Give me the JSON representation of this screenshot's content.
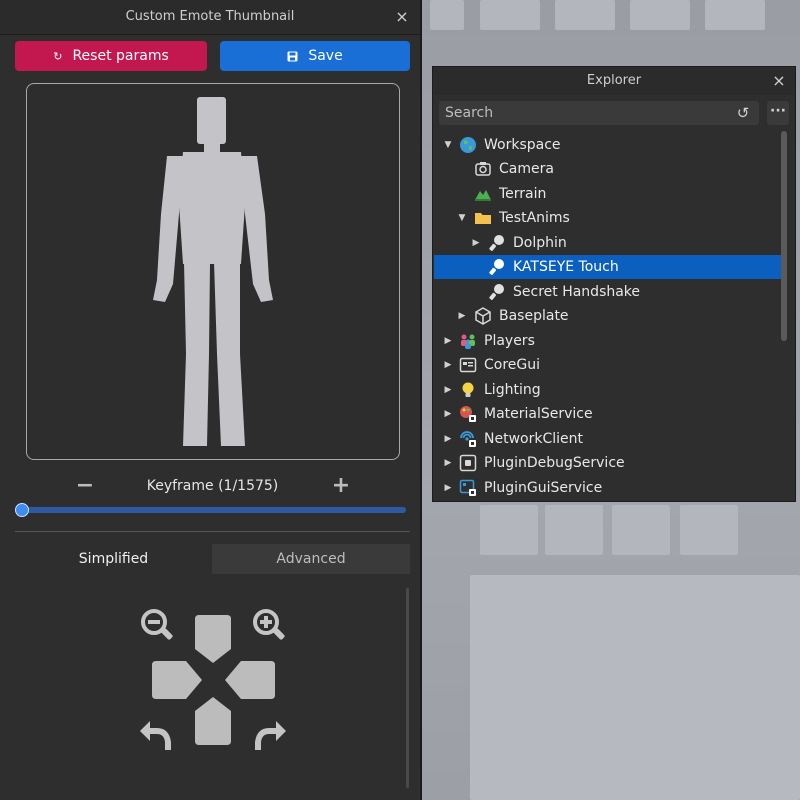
{
  "emote_panel": {
    "title": "Custom Emote Thumbnail",
    "close": "×",
    "reset_label": "Reset params",
    "save_label": "Save",
    "keyframe_minus": "−",
    "keyframe_label": "Keyframe (1/1575)",
    "keyframe_plus": "+",
    "keyframe_progress": 0.0,
    "tabs": {
      "simplified": "Simplified",
      "advanced": "Advanced"
    },
    "active_tab": "Simplified",
    "controls": [
      "zoom-out-icon",
      "zoom-in-icon",
      "pan-up-button",
      "pan-left-button",
      "pan-right-button",
      "pan-down-button",
      "rotate-left-icon",
      "rotate-right-icon"
    ]
  },
  "explorer": {
    "title": "Explorer",
    "close": "×",
    "search_placeholder": "Search",
    "history_icon": "↺",
    "more_icon": "···",
    "items": [
      {
        "label": "Workspace",
        "icon": "globe-icon",
        "expanded": true
      },
      {
        "label": "Camera",
        "icon": "camera-icon"
      },
      {
        "label": "Terrain",
        "icon": "terrain-icon"
      },
      {
        "label": "TestAnims",
        "icon": "folder-icon",
        "expanded": true
      },
      {
        "label": "Dolphin",
        "icon": "animation-icon",
        "expanded": false
      },
      {
        "label": "KATSEYE Touch",
        "icon": "animation-icon",
        "selected": true
      },
      {
        "label": "Secret Handshake",
        "icon": "animation-icon"
      },
      {
        "label": "Baseplate",
        "icon": "part-icon",
        "expanded": false
      },
      {
        "label": "Players",
        "icon": "players-icon",
        "expanded": false
      },
      {
        "label": "CoreGui",
        "icon": "coregui-icon",
        "expanded": false
      },
      {
        "label": "Lighting",
        "icon": "lightbulb-icon",
        "expanded": false
      },
      {
        "label": "MaterialService",
        "icon": "material-service-icon",
        "expanded": false
      },
      {
        "label": "NetworkClient",
        "icon": "network-client-icon",
        "expanded": false
      },
      {
        "label": "PluginDebugService",
        "icon": "plugin-debug-icon",
        "expanded": false
      },
      {
        "label": "PluginGuiService",
        "icon": "plugin-gui-icon",
        "expanded": false
      }
    ]
  },
  "colors": {
    "reset_button": "#c2184f",
    "save_button": "#1a6fd6",
    "selection": "#0b5fbf",
    "panel_bg": "#2e2e2e"
  }
}
